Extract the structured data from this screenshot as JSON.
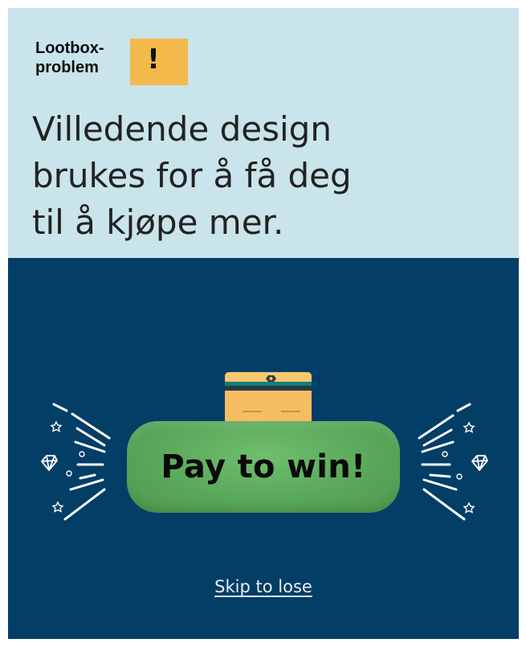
{
  "brand": {
    "line1": "Lootbox-",
    "line2": "problem",
    "mark": "!",
    "mark_color": "#f3b94c"
  },
  "headline": {
    "line1": "Villedende design",
    "line2": "brukes for å få deg",
    "line3": "til å kjøpe mer."
  },
  "cta": {
    "label": "Pay to win!",
    "color": "#5aa85a"
  },
  "skip": {
    "label": "Skip to lose"
  },
  "icons": [
    "treasure-chest-icon",
    "diamond-icon",
    "star-icon",
    "sparkle-burst-icon"
  ],
  "colors": {
    "top_background": "#c9e4ea",
    "bottom_background": "#033e67",
    "chest": "#f5bd61",
    "chest_band": "#2b3a45"
  }
}
